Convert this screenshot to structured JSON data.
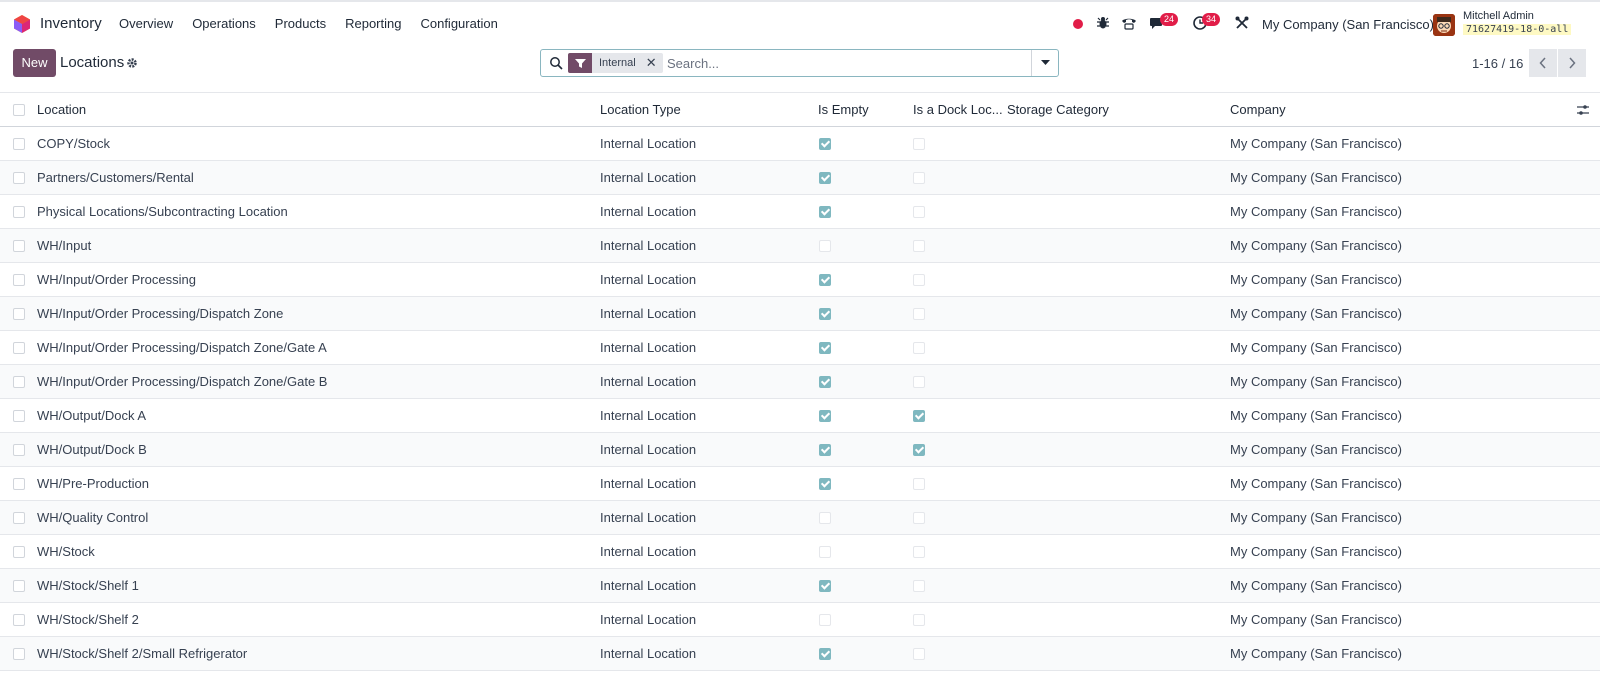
{
  "navbar": {
    "app_name": "Inventory",
    "menu": [
      "Overview",
      "Operations",
      "Products",
      "Reporting",
      "Configuration"
    ],
    "messages_count": "24",
    "activities_count": "34",
    "company": "My Company (San Francisco)",
    "user_name": "Mitchell Admin",
    "database": "71627419-18-0-all"
  },
  "control_panel": {
    "new_label": "New",
    "title": "Locations",
    "facet_label": "Internal",
    "search_placeholder": "Search...",
    "pager": "1-16 / 16"
  },
  "table": {
    "columns": [
      "Location",
      "Location Type",
      "Is Empty",
      "Is a Dock Loc...",
      "Storage Category",
      "Company"
    ],
    "rows": [
      {
        "location": "COPY/Stock",
        "type": "Internal Location",
        "is_empty": true,
        "is_dock": false,
        "storage_category": "",
        "company": "My Company (San Francisco)"
      },
      {
        "location": "Partners/Customers/Rental",
        "type": "Internal Location",
        "is_empty": true,
        "is_dock": false,
        "storage_category": "",
        "company": "My Company (San Francisco)"
      },
      {
        "location": "Physical Locations/Subcontracting Location",
        "type": "Internal Location",
        "is_empty": true,
        "is_dock": false,
        "storage_category": "",
        "company": "My Company (San Francisco)"
      },
      {
        "location": "WH/Input",
        "type": "Internal Location",
        "is_empty": false,
        "is_dock": false,
        "storage_category": "",
        "company": "My Company (San Francisco)"
      },
      {
        "location": "WH/Input/Order Processing",
        "type": "Internal Location",
        "is_empty": true,
        "is_dock": false,
        "storage_category": "",
        "company": "My Company (San Francisco)"
      },
      {
        "location": "WH/Input/Order Processing/Dispatch Zone",
        "type": "Internal Location",
        "is_empty": true,
        "is_dock": false,
        "storage_category": "",
        "company": "My Company (San Francisco)"
      },
      {
        "location": "WH/Input/Order Processing/Dispatch Zone/Gate A",
        "type": "Internal Location",
        "is_empty": true,
        "is_dock": false,
        "storage_category": "",
        "company": "My Company (San Francisco)"
      },
      {
        "location": "WH/Input/Order Processing/Dispatch Zone/Gate B",
        "type": "Internal Location",
        "is_empty": true,
        "is_dock": false,
        "storage_category": "",
        "company": "My Company (San Francisco)"
      },
      {
        "location": "WH/Output/Dock A",
        "type": "Internal Location",
        "is_empty": true,
        "is_dock": true,
        "storage_category": "",
        "company": "My Company (San Francisco)"
      },
      {
        "location": "WH/Output/Dock B",
        "type": "Internal Location",
        "is_empty": true,
        "is_dock": true,
        "storage_category": "",
        "company": "My Company (San Francisco)"
      },
      {
        "location": "WH/Pre-Production",
        "type": "Internal Location",
        "is_empty": true,
        "is_dock": false,
        "storage_category": "",
        "company": "My Company (San Francisco)"
      },
      {
        "location": "WH/Quality Control",
        "type": "Internal Location",
        "is_empty": false,
        "is_dock": false,
        "storage_category": "",
        "company": "My Company (San Francisco)"
      },
      {
        "location": "WH/Stock",
        "type": "Internal Location",
        "is_empty": false,
        "is_dock": false,
        "storage_category": "",
        "company": "My Company (San Francisco)"
      },
      {
        "location": "WH/Stock/Shelf 1",
        "type": "Internal Location",
        "is_empty": true,
        "is_dock": false,
        "storage_category": "",
        "company": "My Company (San Francisco)"
      },
      {
        "location": "WH/Stock/Shelf 2",
        "type": "Internal Location",
        "is_empty": false,
        "is_dock": false,
        "storage_category": "",
        "company": "My Company (San Francisco)"
      },
      {
        "location": "WH/Stock/Shelf 2/Small Refrigerator",
        "type": "Internal Location",
        "is_empty": true,
        "is_dock": false,
        "storage_category": "",
        "company": "My Company (San Francisco)"
      }
    ]
  },
  "colors": {
    "brand": "#714b67",
    "checkbox_checked": "#7fb8c0",
    "badge": "#e11d48"
  },
  "icons": [
    "app-logo-icon",
    "record-icon",
    "bug-icon",
    "phone-icon",
    "chat-icon",
    "clock-icon",
    "tools-icon",
    "gear-icon",
    "search-icon",
    "filter-icon",
    "close-icon",
    "caret-down-icon",
    "chevron-left-icon",
    "chevron-right-icon",
    "column-options-icon"
  ]
}
